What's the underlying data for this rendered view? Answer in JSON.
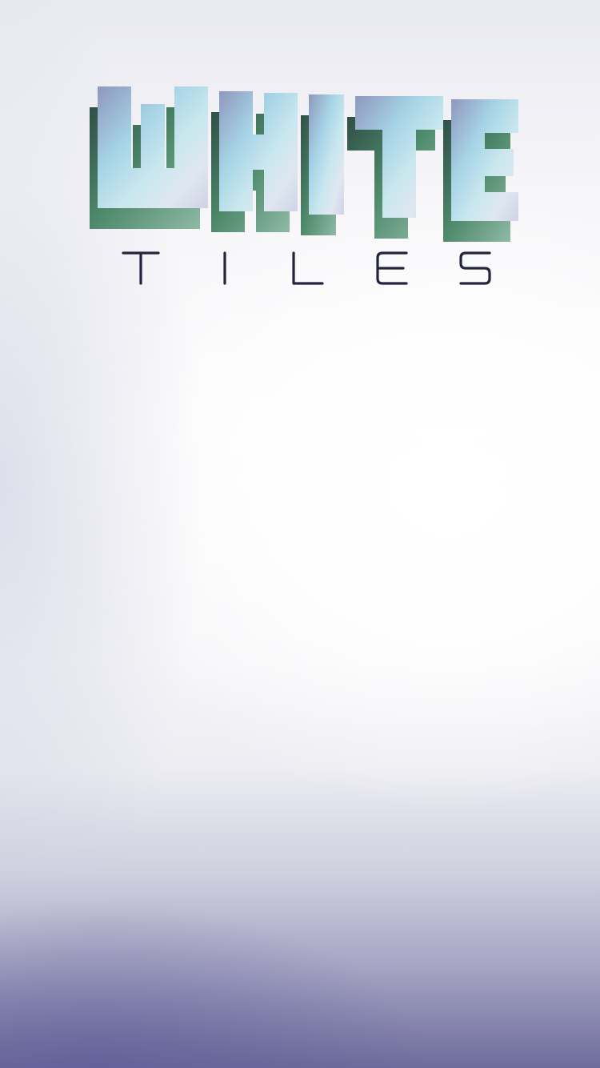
{
  "game": {
    "title_word": "WHITE",
    "subtitle_letters": [
      "T",
      "I",
      "L",
      "E",
      "S"
    ]
  },
  "colors": {
    "logo_face_light": "#a9dbea",
    "logo_face_dark": "#7d8fb2",
    "logo_side": "#3f6e57",
    "subtitle_text": "#23253d",
    "background_top": "#f6f6f9",
    "background_bottom": "#6e6c9b"
  }
}
